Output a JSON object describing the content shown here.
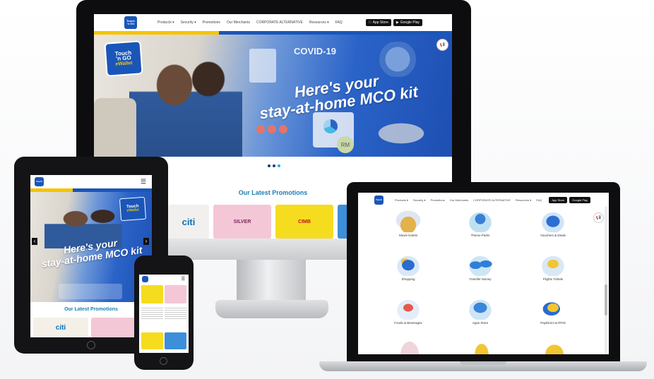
{
  "brand": {
    "logo_line1": "Touch",
    "logo_line2": "'n GO",
    "logo_line3": "eWallet",
    "blue": "#1a56b8",
    "yellow": "#f6c400"
  },
  "desktop": {
    "nav_items": [
      "Products ▾",
      "Security ▾",
      "Promotions",
      "Our Merchants",
      "CORPORATE ALTERNATIVE",
      "Resources ▾",
      "FAQ"
    ],
    "app_store": "App Store",
    "google_play": "Google Play",
    "hero_headline_line1": "Here's your",
    "hero_headline_line2": "stay-at-home MCO kit",
    "hero_covid_label": "COVID-19",
    "hero_rm_label": "RM",
    "latest_promotions_title": "Our Latest Promotions",
    "promo_cards": [
      {
        "text": "citi",
        "bg": "#f2f0ee",
        "color": "#0a6fb7"
      },
      {
        "text": "SILVER",
        "bg": "#f4c7d7",
        "color": "#7a2b5a"
      },
      {
        "text": "CIMB",
        "bg": "#f6dc1e",
        "color": "#c2121b"
      },
      {
        "text": "",
        "bg": "#3c8fd8",
        "color": "#ffffff"
      }
    ]
  },
  "tablet": {
    "hero_headline_line1": "Here's your",
    "hero_headline_line2": "stay-at-home MCO kit",
    "latest_promotions_title": "Our Latest Promotions",
    "prev_arrow": "‹",
    "next_arrow": "›",
    "menu_glyph": "☰",
    "promo_cards": [
      {
        "text": "citi",
        "bg": "#f4f0e8",
        "color": "#0a6fb7"
      },
      {
        "text": "",
        "bg": "#f4c7d7",
        "color": "#7a2b5a"
      }
    ]
  },
  "phone": {
    "menu_glyph": "☰"
  },
  "laptop": {
    "nav_items": [
      "Products ▾",
      "Security ▾",
      "Promotions",
      "Our Merchants",
      "CORPORATE ALTERNATIVE",
      "Resources ▾",
      "FAQ"
    ],
    "app_store": "App Store",
    "google_play": "Google Play",
    "services": [
      {
        "label": "Movie tickets",
        "icon": "ticket-icon"
      },
      {
        "label": "Theme Parks",
        "icon": "park-icon"
      },
      {
        "label": "Vouchers & Deals",
        "icon": "voucher-icon"
      },
      {
        "label": "Shopping",
        "icon": "shopping-icon"
      },
      {
        "label": "Transfer Money",
        "icon": "transfer-icon"
      },
      {
        "label": "Flights Tickets",
        "icon": "flight-icon"
      },
      {
        "label": "Foods & Beverages",
        "icon": "food-icon"
      },
      {
        "label": "Apps Store",
        "icon": "apps-icon"
      },
      {
        "label": "PayDirect & RFID",
        "icon": "rfid-icon"
      }
    ]
  },
  "badge_glyph": "📢"
}
